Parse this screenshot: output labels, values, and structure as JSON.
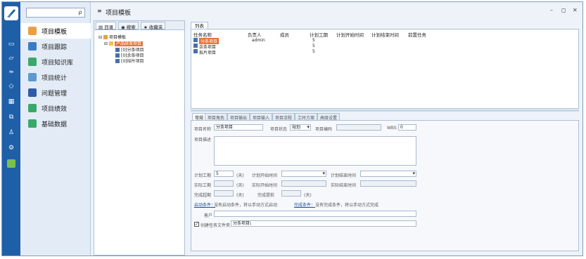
{
  "header": {
    "title": "项目模板"
  },
  "window": {
    "minimize": "–",
    "restore": "◻",
    "close": "✕"
  },
  "search": {
    "value": "",
    "button": "ρ"
  },
  "menu": {
    "items": [
      {
        "label": "项目模板",
        "icon": "template-icon",
        "color": "#e8a040",
        "active": true
      },
      {
        "label": "项目跟踪",
        "icon": "track-icon",
        "color": "#3a7cc2",
        "active": false
      },
      {
        "label": "项目知识库",
        "icon": "knowledge-icon",
        "color": "#3aa86a",
        "active": false
      },
      {
        "label": "项目统计",
        "icon": "stats-icon",
        "color": "#5a9ad0",
        "active": false
      },
      {
        "label": "问题管理",
        "icon": "issue-icon",
        "color": "#2e5ca8",
        "active": false
      },
      {
        "label": "项目绩效",
        "icon": "performance-icon",
        "color": "#3aa86a",
        "active": false
      },
      {
        "label": "基础数据",
        "icon": "data-icon",
        "color": "#3aa86a",
        "active": false
      }
    ]
  },
  "tree": {
    "tabs": [
      "目录",
      "搜索",
      "收藏夹"
    ],
    "root": "项目模板",
    "folder": "产品研发项目",
    "children": [
      "[0]分条项目",
      "[0]余条项目",
      "[0]拟片项目"
    ]
  },
  "list": {
    "tab": "列表",
    "columns": [
      "任务名称",
      "负责人",
      "成员",
      "计划工期",
      "计划开始时间",
      "计划结束时间",
      "前置任务"
    ],
    "rows": [
      {
        "name": "分条项目",
        "owner": "admin",
        "days": "5",
        "selected": true
      },
      {
        "name": "余条项目",
        "owner": "",
        "days": "5",
        "selected": false
      },
      {
        "name": "拟片项目",
        "owner": "",
        "days": "5",
        "selected": false
      }
    ]
  },
  "detail": {
    "tabs": [
      "常规",
      "项目角色",
      "项目输出",
      "项目输入",
      "项目流程",
      "工时方案",
      "高级设置"
    ],
    "name_label": "项目名称",
    "name_value": "分条项目",
    "status_label": "项目状态",
    "status_value": "规划",
    "code_label": "项目编码",
    "code_value": "",
    "wbs_label": "WBS",
    "wbs_value": "0",
    "desc_label": "项目描述",
    "plan_days_label": "计划工期",
    "plan_days_value": "5",
    "unit_day": "(天)",
    "plan_start_label": "计划开始时间",
    "plan_end_label": "计划结束时间",
    "actual_days_label": "实际工期",
    "actual_start_label": "实际开始时间",
    "actual_end_label": "实际结束时间",
    "overdue_label": "完成超期",
    "advance_label": "完成提前",
    "start_cond_link": "启动条件：",
    "start_cond_text": "没有启动条件，将以手动方式启动",
    "finish_cond_link": "完成条件：",
    "finish_cond_text": "没有完成条件，将以手动方式完成",
    "customer_label": "客户",
    "create_folder_label": "创建任务文件夹",
    "create_folder_value": "分条项目\\"
  }
}
